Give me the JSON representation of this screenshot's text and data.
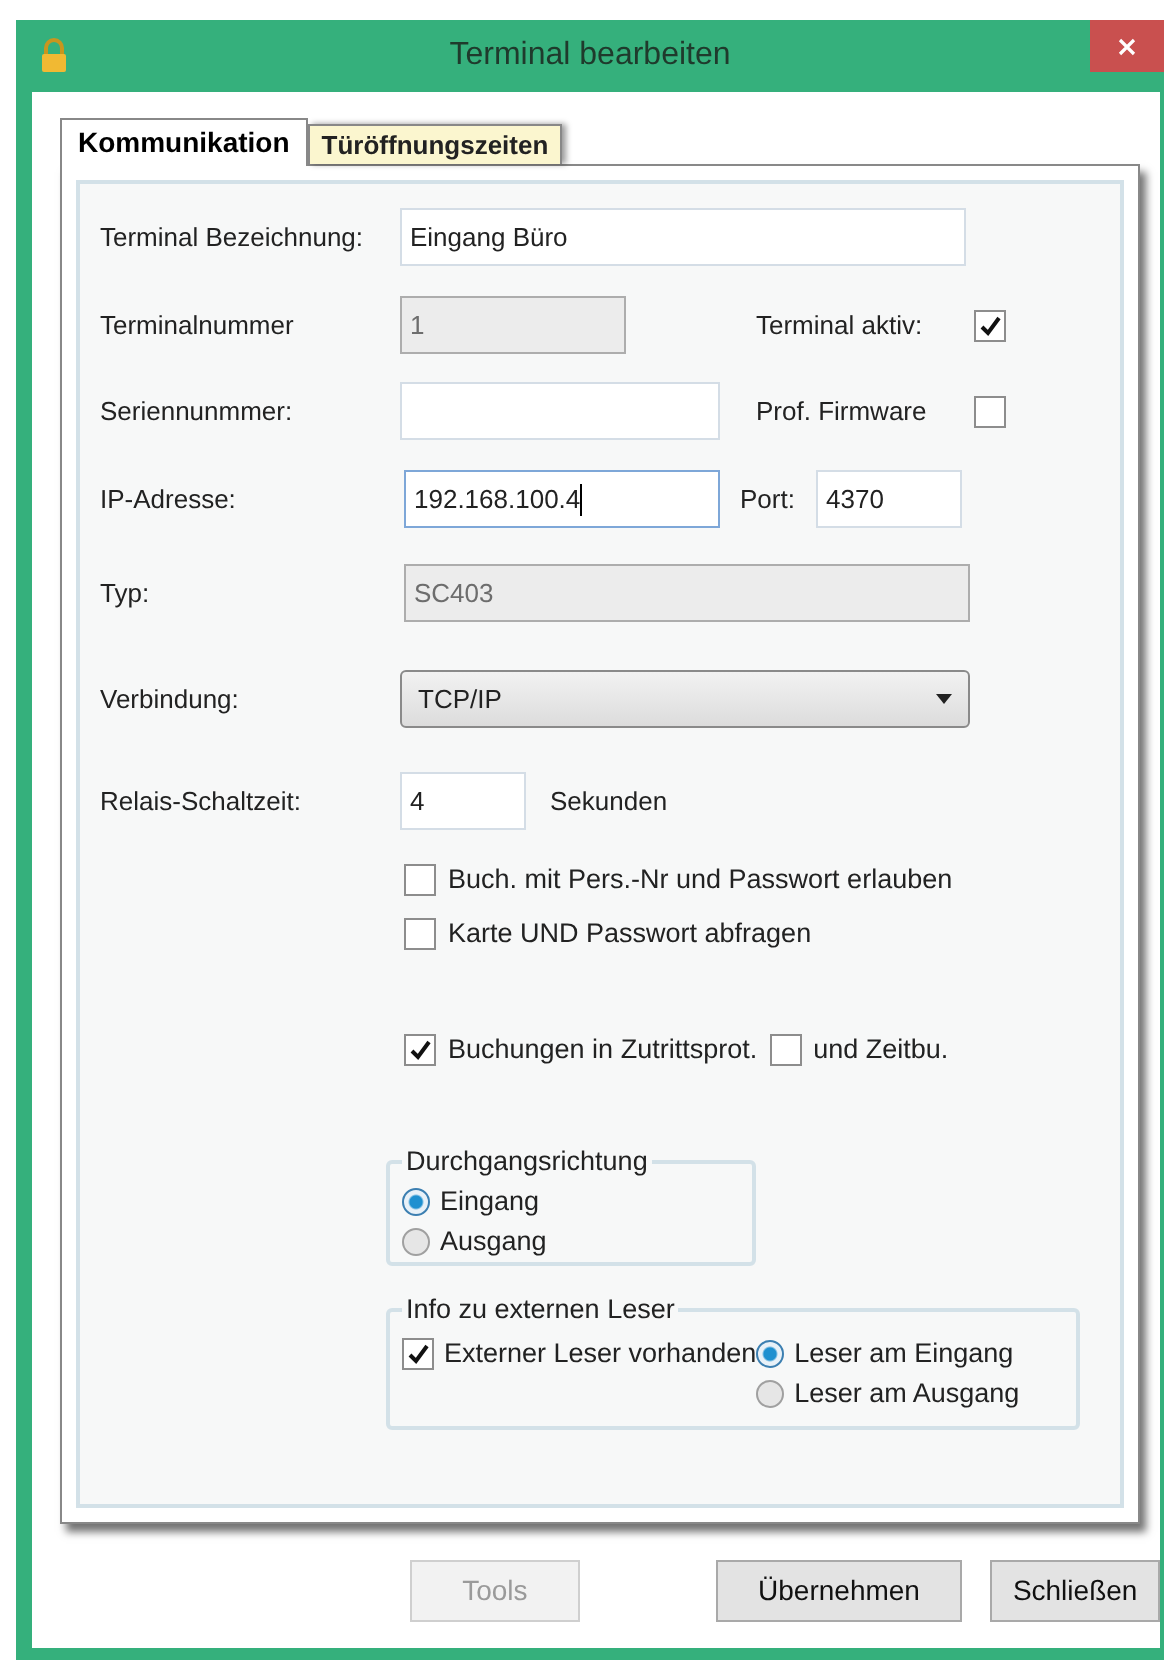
{
  "window": {
    "title": "Terminal bearbeiten"
  },
  "tabs": [
    {
      "label": "Kommunikation",
      "selected": true
    },
    {
      "label": "Türöffnungszeiten",
      "selected": false
    }
  ],
  "form": {
    "terminal_bezeichnung": {
      "label": "Terminal Bezeichnung:",
      "value": "Eingang Büro",
      "disabled": false
    },
    "terminalnummer": {
      "label": "Terminalnummer",
      "value": "1",
      "disabled": true
    },
    "terminal_aktiv": {
      "label": "Terminal aktiv:",
      "checked": true
    },
    "seriennummer": {
      "label": "Seriennunmmer:",
      "disabled": false
    },
    "prof_firmware": {
      "label": "Prof. Firmware",
      "checked": false
    },
    "ip_adresse": {
      "label": "IP-Adresse:",
      "value": "192.168.100.4",
      "disabled": false,
      "focused": true
    },
    "port": {
      "label": "Port:",
      "value": "4370",
      "disabled": false
    },
    "typ": {
      "label": "Typ:",
      "value": "SC403",
      "disabled": true
    },
    "verbindung": {
      "label": "Verbindung:",
      "value": "TCP/IP"
    },
    "relais_schaltzeit": {
      "label": "Relais-Schaltzeit:",
      "value": "4",
      "disabled": false,
      "unit": "Sekunden"
    },
    "options": [
      {
        "label": "Buch. mit Pers.-Nr und Passwort erlauben",
        "checked": false
      },
      {
        "label": "Karte UND Passwort abfragen",
        "checked": false
      }
    ],
    "buchungen": [
      {
        "label": "Buchungen in Zutrittsprot.",
        "checked": true
      },
      {
        "label": "und Zeitbu.",
        "checked": false
      }
    ]
  },
  "durchgangsrichtung": {
    "title": "Durchgangsrichtung",
    "options": [
      {
        "label": "Eingang",
        "selected": true
      },
      {
        "label": "Ausgang",
        "selected": false
      }
    ]
  },
  "externer_leser": {
    "title": "Info zu externen Leser",
    "checkbox": {
      "label": "Externer Leser vorhanden",
      "checked": true
    },
    "options": [
      {
        "label": "Leser am Eingang",
        "selected": true
      },
      {
        "label": "Leser am Ausgang",
        "selected": false
      }
    ]
  },
  "buttons": [
    {
      "label": "Tools",
      "disabled": true
    },
    {
      "label": "Übernehmen",
      "disabled": false
    },
    {
      "label": "Schließen",
      "disabled": false
    }
  ]
}
